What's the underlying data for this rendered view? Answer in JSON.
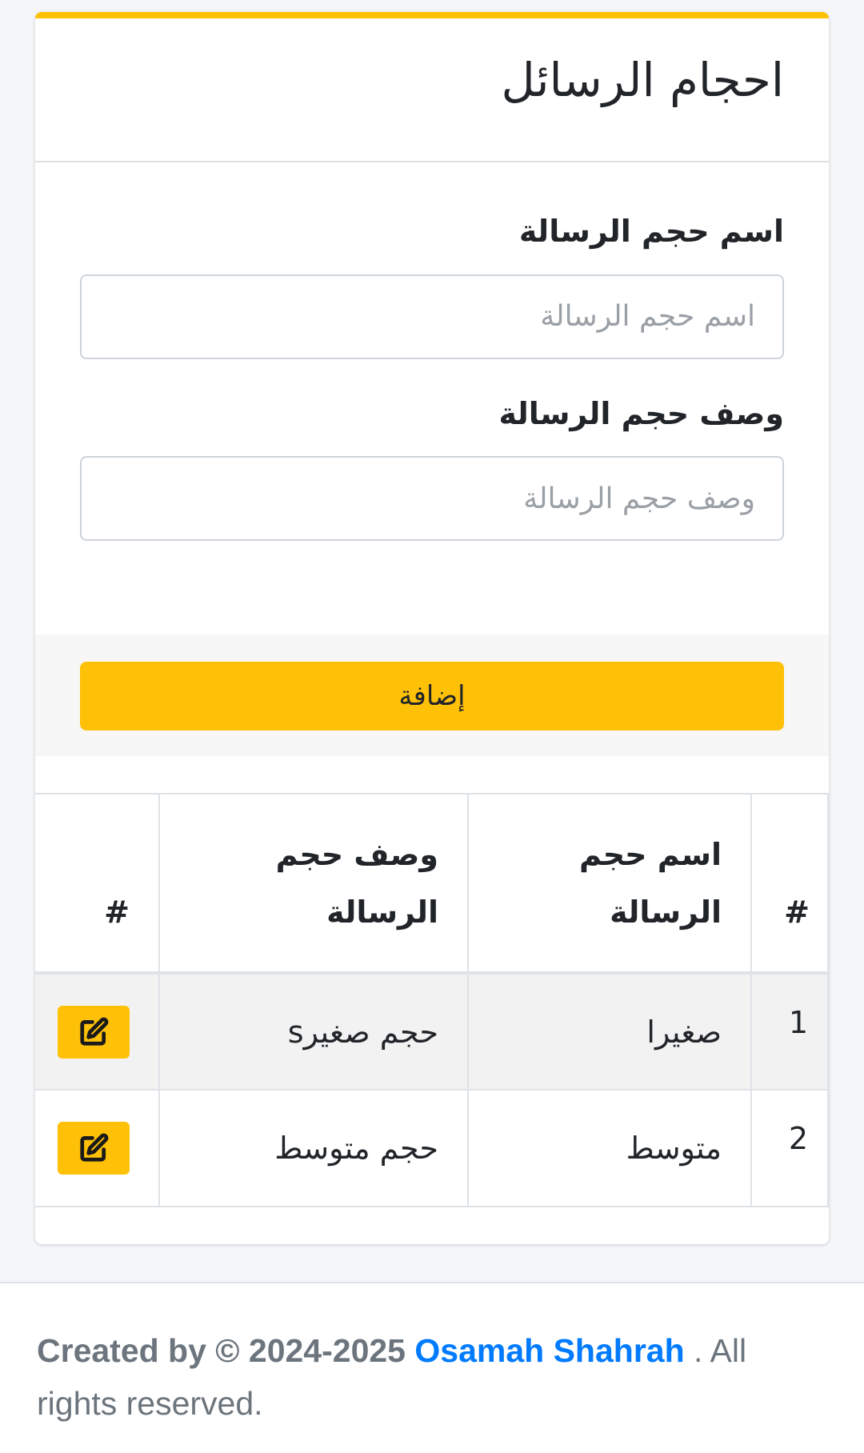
{
  "page": {
    "title": "احجام الرسائل"
  },
  "form": {
    "name_label": "اسم حجم الرسالة",
    "name_placeholder": "اسم حجم الرسالة",
    "name_value": "",
    "desc_label": "وصف حجم الرسالة",
    "desc_placeholder": "وصف حجم الرسالة",
    "desc_value": "",
    "submit_label": "إضافة"
  },
  "table": {
    "headers": [
      "#",
      "اسم حجم الرسالة",
      "وصف حجم الرسالة",
      "#"
    ],
    "rows": [
      {
        "num": "1",
        "name": "صغيرا",
        "description": "حجم صغيرs",
        "action_icon": "edit-icon"
      },
      {
        "num": "2",
        "name": "متوسط",
        "description": "حجم متوسط",
        "action_icon": "edit-icon"
      }
    ]
  },
  "footer": {
    "created_by": "Created by © 2024-2025",
    "author": "Osamah Shahrah",
    "rights": ". All rights reserved."
  },
  "colors": {
    "accent": "#ffc107",
    "link": "#007bff",
    "muted_text": "#6c757d",
    "background": "#f4f6f9"
  }
}
